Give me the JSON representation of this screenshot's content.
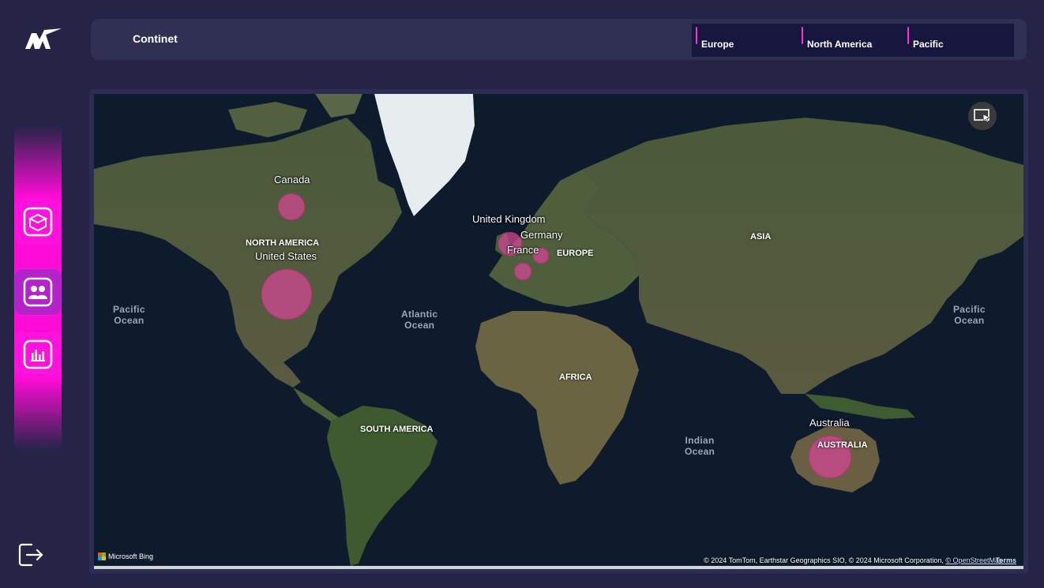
{
  "header": {
    "title": "Continet"
  },
  "slicer": {
    "options": [
      "Europe",
      "North America",
      "Pacific"
    ]
  },
  "nav": {
    "items": [
      "product-icon",
      "customers-icon",
      "report-icon"
    ],
    "logout": "logout-icon",
    "accent": "#ff13dc"
  },
  "map": {
    "oceans": [
      {
        "line1": "Pacific",
        "line2": "Ocean"
      },
      {
        "line1": "Atlantic",
        "line2": "Ocean"
      },
      {
        "line1": "Indian",
        "line2": "Ocean"
      },
      {
        "line1": "Pacific",
        "line2": "Ocean"
      }
    ],
    "continents": [
      "NORTH AMERICA",
      "EUROPE",
      "ASIA",
      "AFRICA",
      "SOUTH AMERICA",
      "AUSTRALIA"
    ],
    "locations": [
      {
        "name": "Canada"
      },
      {
        "name": "United States"
      },
      {
        "name": "United Kingdom"
      },
      {
        "name": "Germany"
      },
      {
        "name": "France"
      },
      {
        "name": "Australia"
      }
    ],
    "bubble_color": "#d64696",
    "attribution": {
      "bing": "Microsoft Bing",
      "credits_text": "© 2024 TomTom, Earthstar Geographics SIO, © 2024 Microsoft Corporation, ",
      "osm": "© OpenStreetMap",
      "terms": "Terms"
    }
  }
}
